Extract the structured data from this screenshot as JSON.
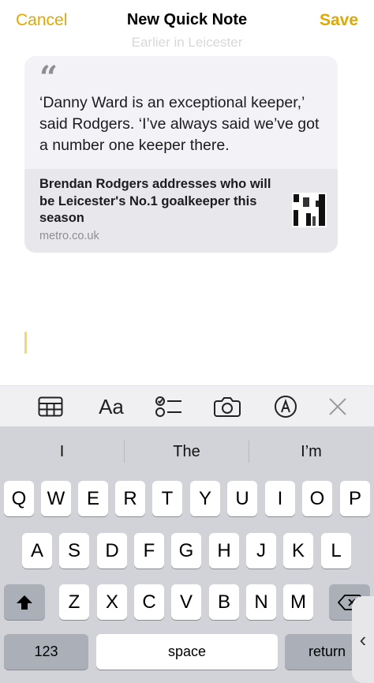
{
  "nav": {
    "cancel": "Cancel",
    "title": "New Quick Note",
    "save": "Save"
  },
  "ghost_text": "Earlier in Leicester",
  "card": {
    "quote_mark": "“",
    "quote": "‘Danny Ward is an exceptional keeper,’ said Rodgers. ‘I’ve always said we’ve got a number one keeper there.",
    "link_title": "Brendan Rodgers addresses who will be Leicester's No.1 goalkeeper this season",
    "link_source": "metro.co.uk"
  },
  "toolbar": {
    "icons": [
      "table-icon",
      "text-format-icon",
      "checklist-icon",
      "camera-icon",
      "markup-pen-icon",
      "close-icon"
    ],
    "format_label": "Aa"
  },
  "suggestions": [
    "I",
    "The",
    "I’m"
  ],
  "keys": {
    "row1": [
      "Q",
      "W",
      "E",
      "R",
      "T",
      "Y",
      "U",
      "I",
      "O",
      "P"
    ],
    "row2": [
      "A",
      "S",
      "D",
      "F",
      "G",
      "H",
      "J",
      "K",
      "L"
    ],
    "row3": [
      "Z",
      "X",
      "C",
      "V",
      "B",
      "N",
      "M"
    ],
    "numbers": "123",
    "space": "space",
    "return": "return"
  },
  "edge_glyph": "‹",
  "colors": {
    "accent": "#e0a800",
    "card_bg": "#f2f2f7",
    "link_bg": "#e7e7ec",
    "keyboard_bg": "#d1d3d9"
  }
}
